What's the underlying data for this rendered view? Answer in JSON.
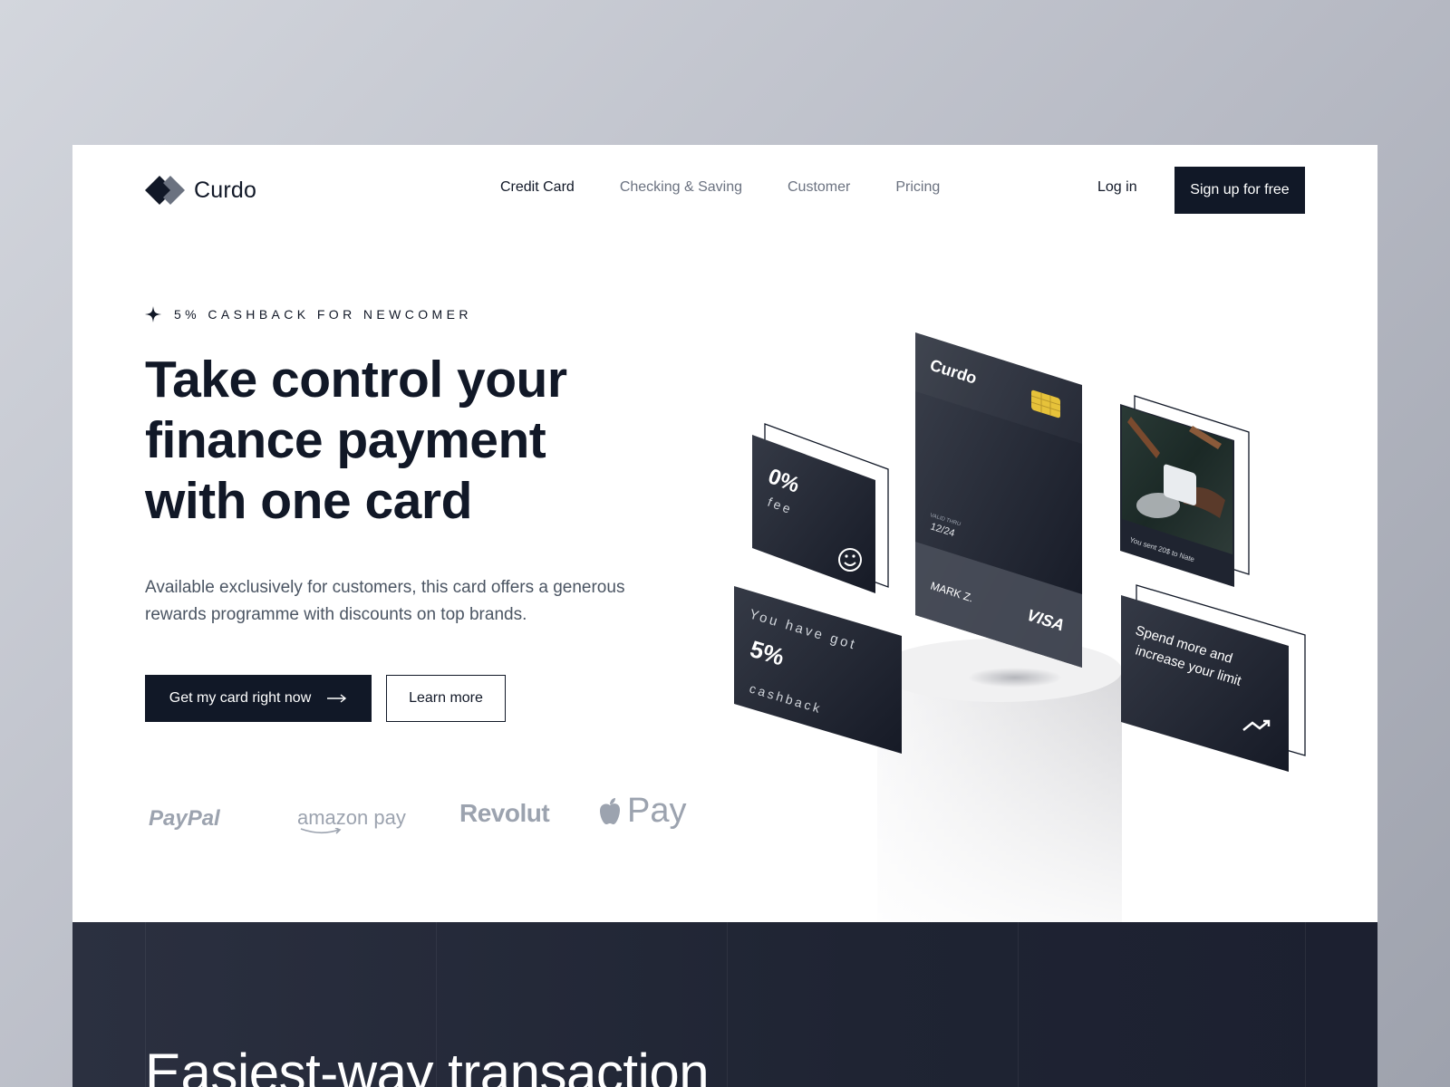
{
  "brand": {
    "name": "Curdo"
  },
  "nav": {
    "items": [
      {
        "label": "Credit Card",
        "active": true
      },
      {
        "label": "Checking & Saving",
        "active": false
      },
      {
        "label": "Customer",
        "active": false
      },
      {
        "label": "Pricing",
        "active": false
      }
    ],
    "login": "Log in",
    "signup": "Sign up for free"
  },
  "hero": {
    "eyebrow": "5% CASHBACK FOR NEWCOMER",
    "headline_lines": [
      "Take control your",
      "finance payment",
      "with one card"
    ],
    "description": "Available exclusively for customers, this card offers a generous rewards programme with discounts on top brands.",
    "primary_cta": "Get my card right now",
    "secondary_cta": "Learn more"
  },
  "partners": [
    "PayPal",
    "amazon pay",
    "Revolut",
    "Pay"
  ],
  "illustration": {
    "card_brand": "Curdo",
    "valid_thru_label": "VALID THRU",
    "valid_thru": "12/24",
    "card_holder": "MARK Z.",
    "network": "VISA",
    "fee_value": "0%",
    "fee_label": "fee",
    "cashback_intro": "You have got",
    "cashback_value": "5%",
    "cashback_label": "cashback",
    "transfer_note": "You sent 20$ to Nate",
    "limit_line1": "Spend more and",
    "limit_line2": "increase your limit"
  },
  "section2": {
    "title": "Easiest-way transaction"
  },
  "colors": {
    "primary": "#111827",
    "text_muted": "#6b7280",
    "background": "#ffffff",
    "card_dark": "#1f2430"
  },
  "icons": [
    "logo-diamond-icon",
    "sparkle-icon",
    "arrow-right-icon",
    "smiley-icon",
    "trend-up-icon",
    "apple-icon",
    "chip-icon"
  ]
}
